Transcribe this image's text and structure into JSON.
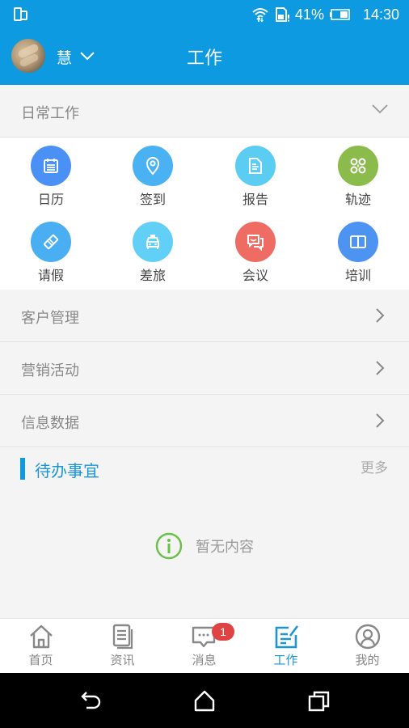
{
  "status_bar": {
    "battery_percent": "41%",
    "time": "14:30",
    "icons": [
      "screen-mirror-icon",
      "wifi-icon",
      "sim-alert-icon",
      "battery-icon"
    ]
  },
  "app_bar": {
    "user_name": "慧",
    "title": "工作",
    "brand_color": "#0e9ae0"
  },
  "daily_work": {
    "header": "日常工作",
    "tiles": [
      {
        "label": "日历",
        "icon": "calendar-icon",
        "color": "#4a90f5"
      },
      {
        "label": "签到",
        "icon": "location-pin-icon",
        "color": "#4ab1f2"
      },
      {
        "label": "报告",
        "icon": "report-document-icon",
        "color": "#5bcdf2"
      },
      {
        "label": "轨迹",
        "icon": "track-icon",
        "color": "#8bbb4a"
      },
      {
        "label": "请假",
        "icon": "ticket-icon",
        "color": "#4aaef2"
      },
      {
        "label": "差旅",
        "icon": "taxi-icon",
        "color": "#62cff7"
      },
      {
        "label": "会议",
        "icon": "chat-bubbles-icon",
        "color": "#ee6c64"
      },
      {
        "label": "培训",
        "icon": "book-icon",
        "color": "#4c93f2"
      }
    ]
  },
  "menu": [
    {
      "label": "客户管理"
    },
    {
      "label": "营销活动"
    },
    {
      "label": "信息数据"
    }
  ],
  "todo": {
    "title": "待办事宜",
    "more": "更多",
    "empty_text": "暂无内容"
  },
  "tab_bar": {
    "tabs": [
      {
        "label": "首页",
        "icon": "home-icon",
        "active": false
      },
      {
        "label": "资讯",
        "icon": "news-icon",
        "active": false
      },
      {
        "label": "消息",
        "icon": "message-icon",
        "active": false,
        "badge": "1"
      },
      {
        "label": "工作",
        "icon": "work-icon",
        "active": true
      },
      {
        "label": "我的",
        "icon": "profile-icon",
        "active": false
      }
    ],
    "active_color": "#1a96d4"
  },
  "nav_bar": {
    "buttons": [
      "back-icon",
      "home-nav-icon",
      "recents-icon"
    ]
  }
}
